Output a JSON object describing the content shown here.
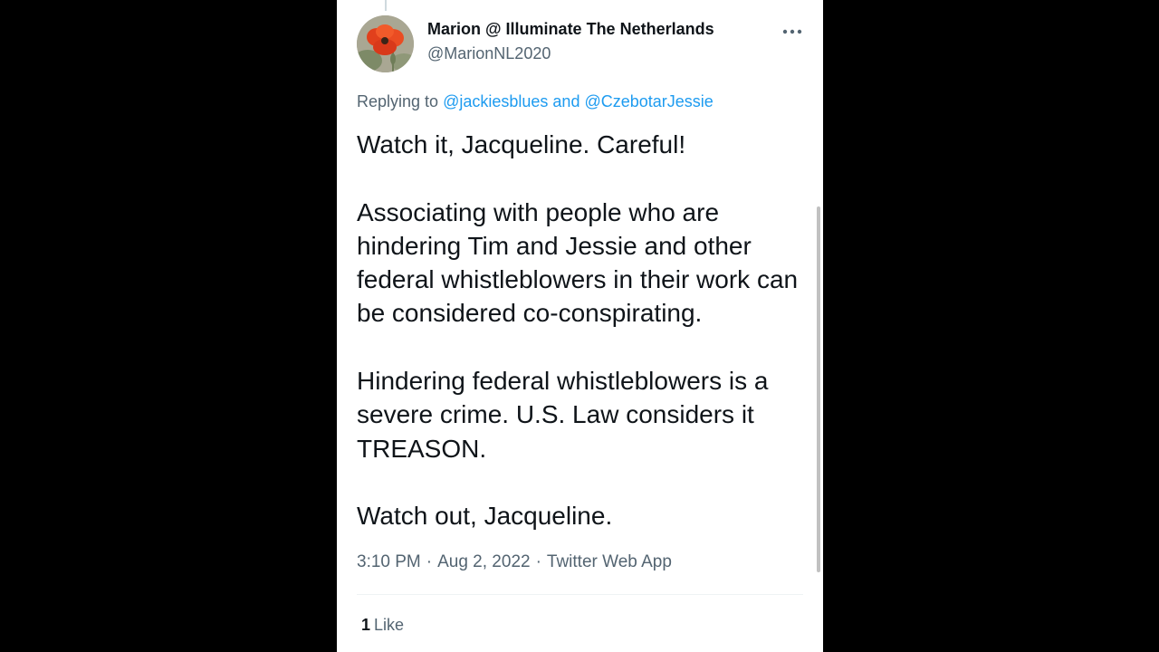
{
  "tweet": {
    "author": {
      "display_name": "Marion @ Illuminate The Netherlands",
      "handle": "@MarionNL2020",
      "avatar_icon": "red-poppy-photo"
    },
    "more_icon": "more-horizontal-icon",
    "replying_to": {
      "prefix": "Replying to",
      "first": "@jackiesblues",
      "conjunction": "and",
      "second": "@CzebotarJessie"
    },
    "paragraphs": [
      "Watch it, Jacqueline. Careful!",
      "Associating with people who are hindering Tim and Jessie and other federal whistleblowers in their work can be considered co-conspirating.",
      "Hindering federal whistleblowers is a severe crime. U.S. Law considers it TREASON.",
      "Watch out, Jacqueline."
    ],
    "time": "3:10 PM",
    "date": "Aug 2, 2022",
    "separator": "·",
    "source": "Twitter Web App",
    "likes": {
      "count": "1",
      "label": "Like"
    }
  },
  "colors": {
    "background_outer": "#000000",
    "panel": "#ffffff",
    "text_primary": "#0f1419",
    "text_secondary": "#536471",
    "link": "#1d9bf0",
    "divider": "#eff3f4"
  }
}
